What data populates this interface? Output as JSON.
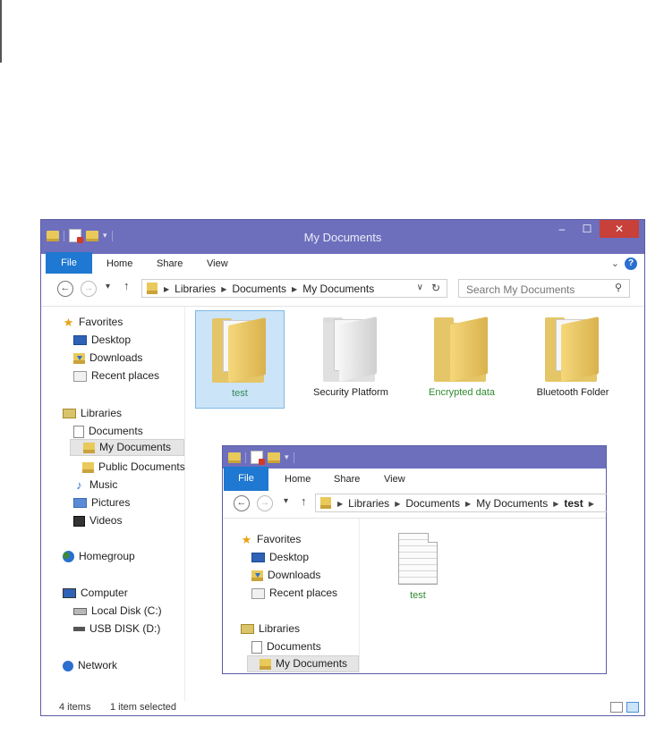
{
  "main_window": {
    "title": "My Documents",
    "window_controls": {
      "minimize": "–",
      "maximize": "☐",
      "close": "✕"
    },
    "ribbon": {
      "tabs": [
        "File",
        "Home",
        "Share",
        "View"
      ],
      "expand": "⌄",
      "help": "?"
    },
    "address": {
      "crumbs": [
        "Libraries",
        "Documents",
        "My Documents"
      ],
      "search_placeholder": "Search My Documents"
    },
    "nav": {
      "favorites": {
        "label": "Favorites",
        "items": [
          "Desktop",
          "Downloads",
          "Recent places"
        ]
      },
      "libraries": {
        "label": "Libraries",
        "documents": "Documents",
        "items": [
          "My Documents",
          "Public Documents"
        ],
        "others": [
          "Music",
          "Pictures",
          "Videos"
        ]
      },
      "homegroup": "Homegroup",
      "computer": {
        "label": "Computer",
        "items": [
          "Local Disk (C:)",
          "USB DISK (D:)"
        ]
      },
      "network": "Network"
    },
    "files": [
      {
        "name": "test",
        "color": "#2e8b57"
      },
      {
        "name": "Security Platform",
        "color": "#222222"
      },
      {
        "name": "Encrypted data",
        "color": "#2e8b2e"
      },
      {
        "name": "Bluetooth Folder",
        "color": "#222222"
      }
    ],
    "status": {
      "count": "4 items",
      "selection": "1 item selected"
    }
  },
  "inset_window": {
    "ribbon": {
      "tabs": [
        "File",
        "Home",
        "Share",
        "View"
      ]
    },
    "address": {
      "crumbs": [
        "Libraries",
        "Documents",
        "My Documents",
        "test"
      ]
    },
    "nav": {
      "favorites": {
        "label": "Favorites",
        "items": [
          "Desktop",
          "Downloads",
          "Recent places"
        ]
      },
      "libraries": {
        "label": "Libraries",
        "documents": "Documents",
        "items": [
          "My Documents"
        ]
      }
    },
    "files": [
      {
        "name": "test",
        "color": "#2e8b2e"
      }
    ]
  },
  "colors": {
    "titlebar": "#6d6fbd",
    "file_tab": "#1f78d1",
    "selection": "#cce4f7",
    "close": "#c7403a"
  }
}
